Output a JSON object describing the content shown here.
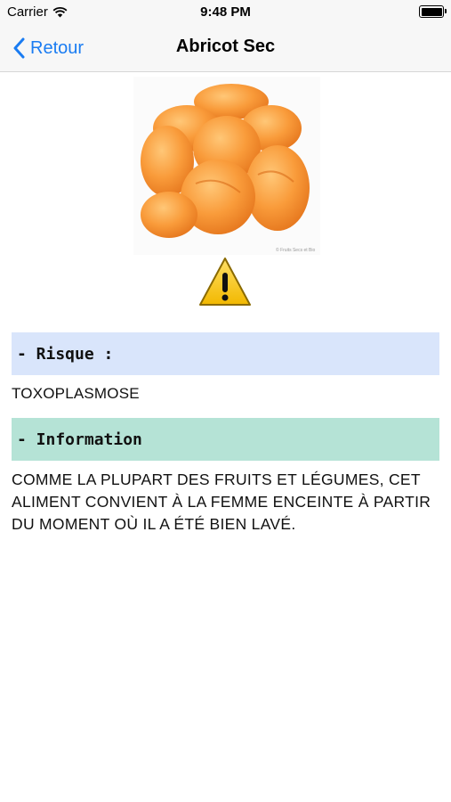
{
  "status_bar": {
    "carrier": "Carrier",
    "time": "9:48 PM"
  },
  "nav": {
    "back_label": "Retour",
    "title": "Abricot Sec"
  },
  "image": {
    "subject": "dried apricots",
    "watermark": "© Fruits Secs et Bio"
  },
  "sections": {
    "risk_label": "- Risque :",
    "risk_value": "TOXOPLASMOSE",
    "info_label": "- Information",
    "info_text": "COMME LA PLUPART DES FRUITS ET LÉGUMES, CET ALIMENT CONVIENT À LA FEMME ENCEINTE À PARTIR DU MOMENT OÙ IL A ÉTÉ BIEN LAVÉ."
  },
  "colors": {
    "accent": "#1a7cf2",
    "risk_header_bg": "#d9e5fb",
    "info_header_bg": "#b5e3d6",
    "warning_yellow": "#f5c400"
  },
  "icons": [
    "wifi-icon",
    "battery-icon",
    "chevron-left-icon",
    "warning-icon"
  ]
}
